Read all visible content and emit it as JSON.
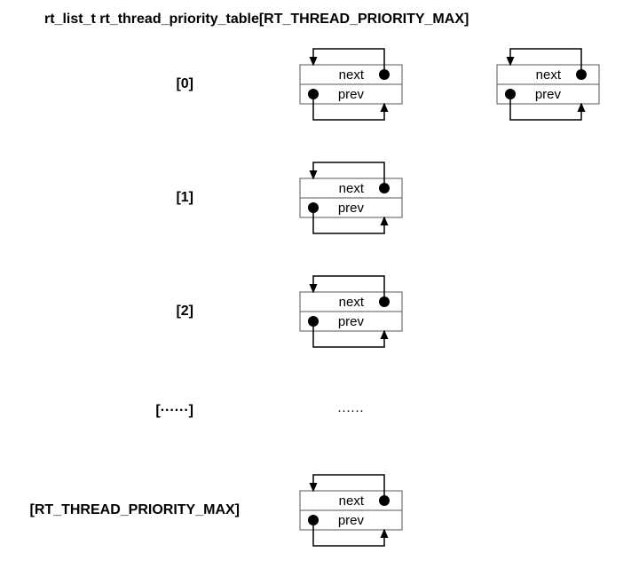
{
  "title": "rt_list_t rt_thread_priority_table[RT_THREAD_PRIORITY_MAX]",
  "indices": {
    "i0": "[0]",
    "i1": "[1]",
    "i2": "[2]",
    "dots": "[······]",
    "last": "[RT_THREAD_PRIORITY_MAX]"
  },
  "fields": {
    "next": "next",
    "prev": "prev"
  },
  "ellipsis_cell": "······"
}
